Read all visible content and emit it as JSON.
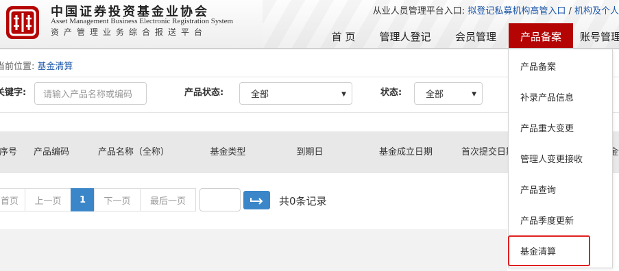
{
  "header": {
    "logo_cn": "中国证券投资基金业协会",
    "logo_en": "Asset Management Business Electronic Registration System",
    "logo_sub": "资产管理业务综合报送平台",
    "portal_prefix": "从业人员管理平台入口:",
    "portal_link1": "拟登记私募机构高管入口",
    "portal_sep": " / ",
    "portal_link2": "机构及个人"
  },
  "nav": {
    "home": "首 页",
    "manager_reg": "管理人登记",
    "member_mgmt": "会员管理",
    "product_filing": "产品备案",
    "account_mgmt": "账号管理"
  },
  "breadcrumb": {
    "prefix": "当前位置:",
    "current": "基金清算"
  },
  "filters": {
    "keyword_label": "关键字:",
    "keyword_placeholder": "请输入产品名称或编码",
    "product_status_label": "产品状态:",
    "product_status_value": "全部",
    "status_label": "状态:",
    "status_value": "全部"
  },
  "table": {
    "columns": [
      "序号",
      "产品编码",
      "产品名称（全称）",
      "基金类型",
      "到期日",
      "基金成立日期",
      "首次提交日期",
      "基金清算"
    ]
  },
  "pagination": {
    "first": "首页",
    "prev": "上一页",
    "current_page": "1",
    "next": "下一页",
    "last": "最后一页",
    "jump_value": "",
    "total": "共0条记录"
  },
  "dropdown": {
    "items": [
      "产品备案",
      "补录产品信息",
      "产品重大变更",
      "管理人变更接收",
      "产品查询",
      "产品季度更新",
      "基金清算"
    ]
  },
  "colors": {
    "brand_red": "#b40404",
    "link_blue": "#1a56a8",
    "accent_blue": "#3a86c8",
    "highlight": "#e02020"
  },
  "icons": {
    "logo": "association-seal-icon",
    "jump": "arrow-right-icon",
    "select_caret": "caret-down-icon"
  }
}
